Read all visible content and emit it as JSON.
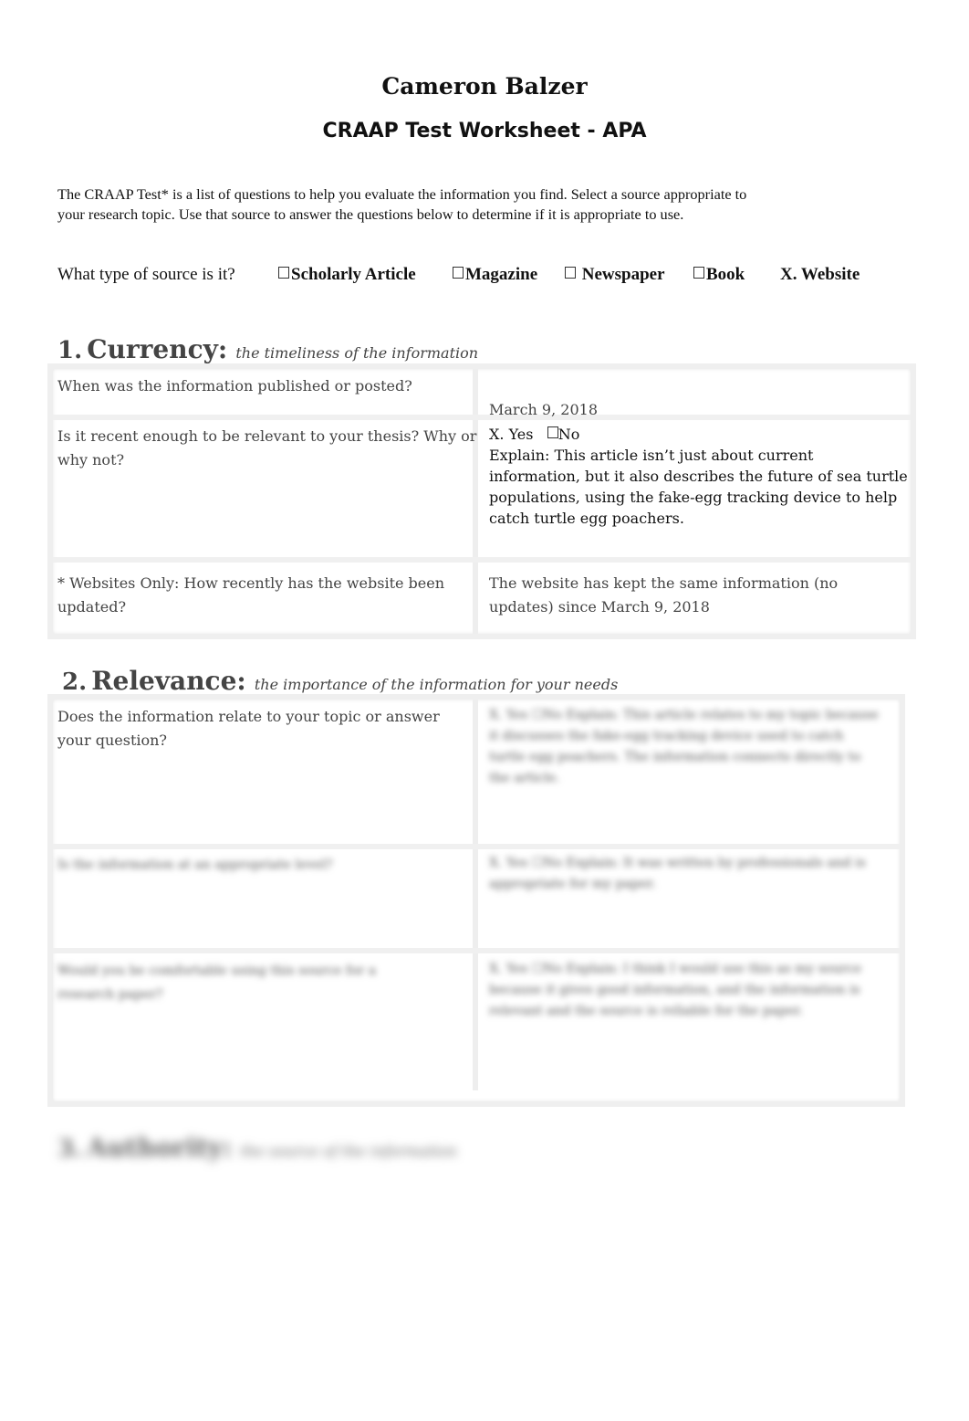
{
  "header": {
    "student_name": "Cameron Balzer",
    "worksheet_title": "CRAAP Test Worksheet - APA"
  },
  "intro": {
    "line1": "The CRAAP Test* is a list of questions to help you evaluate the information you find. Select a source appropriate to",
    "line2": "your research topic.  Use that source to answer the questions below to determine if it is appropriate to use."
  },
  "source_type": {
    "question": "What type of source is it?",
    "options": [
      {
        "label": "Scholarly Article",
        "marker": "☐",
        "selected": false
      },
      {
        "label": "Magazine",
        "marker": "☐",
        "selected": false
      },
      {
        "label": "Newspaper",
        "marker": "☐",
        "selected": false
      },
      {
        "label": "Book",
        "marker": "☐",
        "selected": false
      },
      {
        "label": "Website",
        "marker": "X.",
        "selected": true
      }
    ]
  },
  "sections": [
    {
      "number": "1.",
      "title": "Currency:",
      "description": "the timeliness of the information",
      "rows": [
        {
          "question": "When was the information published or posted?",
          "answer": "March 9, 2018"
        },
        {
          "question": "Is it recent enough to be relevant to your thesis? Why or why not?",
          "yes_label": "X. Yes",
          "no_label": "No",
          "no_marker": "☐",
          "answer": "Explain: This article isn’t just about current information, but it also describes the future of sea turtle populations, using the fake-egg tracking device to help catch turtle egg poachers."
        },
        {
          "question": "* Websites Only: How recently has the website been updated?",
          "answer": "The website has kept the same information (no updates) since March 9, 2018"
        }
      ]
    },
    {
      "number": "2.",
      "title": "Relevance:",
      "description": "the importance of the information for your needs",
      "rows": [
        {
          "question": "Does the information relate to your topic or answer your question?",
          "answer_blurred": "X. Yes ☐No Explain: This article relates to my topic because it discusses the fake-egg tracking device used to catch turtle egg poachers. The information connects directly to the article."
        },
        {
          "question_blurred": "Is the information at an appropriate level?",
          "answer_blurred": "X. Yes ☐No Explain: It was written by professionals and is appropriate for my paper."
        },
        {
          "question_blurred": "Would you be comfortable using this source for a research paper?",
          "answer_blurred": "X. Yes ☐No Explain: I think I would use this as my source because it gives good information, and the information is relevant and the source is reliable for the paper."
        }
      ]
    },
    {
      "number": "3.",
      "title": "Authority:",
      "description": "the source of the information"
    }
  ]
}
